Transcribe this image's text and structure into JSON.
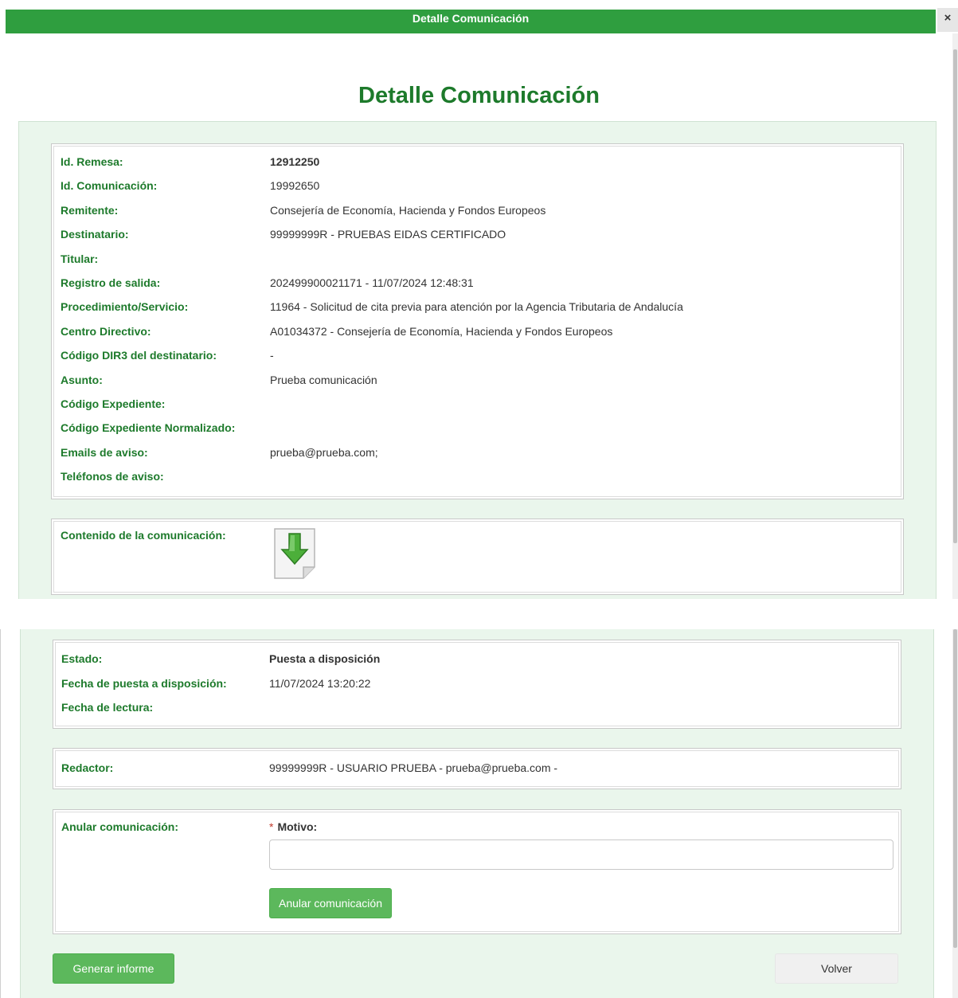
{
  "window": {
    "title": "Detalle Comunicación",
    "close_icon": "×"
  },
  "page_title": "Detalle Comunicación",
  "details": [
    {
      "label": "Id. Remesa:",
      "value": "12912250",
      "bold": true
    },
    {
      "label": "Id. Comunicación:",
      "value": "19992650"
    },
    {
      "label": "Remitente:",
      "value": "Consejería de Economía, Hacienda y Fondos Europeos"
    },
    {
      "label": "Destinatario:",
      "value": "99999999R - PRUEBAS EIDAS CERTIFICADO"
    },
    {
      "label": "Titular:",
      "value": ""
    },
    {
      "label": "Registro de salida:",
      "value": "202499900021171 - 11/07/2024 12:48:31"
    },
    {
      "label": "Procedimiento/Servicio:",
      "value": "11964 - Solicitud de cita previa para atención por la Agencia Tributaria de Andalucía"
    },
    {
      "label": "Centro Directivo:",
      "value": "A01034372 - Consejería de Economía, Hacienda y Fondos Europeos"
    },
    {
      "label": "Código DIR3 del destinatario:",
      "value": "-"
    },
    {
      "label": "Asunto:",
      "value": "Prueba comunicación"
    },
    {
      "label": "Código Expediente:",
      "value": ""
    },
    {
      "label": "Código Expediente Normalizado:",
      "value": ""
    },
    {
      "label": "Emails de aviso:",
      "value": "prueba@prueba.com;"
    },
    {
      "label": "Teléfonos de aviso:",
      "value": ""
    }
  ],
  "content": {
    "label": "Contenido de la comunicación:",
    "icon": "download-document-icon"
  },
  "status": [
    {
      "label": "Estado:",
      "value": "Puesta a disposición",
      "bold": true
    },
    {
      "label": "Fecha de puesta a disposición:",
      "value": "11/07/2024 13:20:22"
    },
    {
      "label": "Fecha de lectura:",
      "value": ""
    }
  ],
  "redactor": {
    "label": "Redactor:",
    "value": "99999999R - USUARIO PRUEBA - prueba@prueba.com -"
  },
  "anular": {
    "label": "Anular comunicación:",
    "required_mark": "*",
    "motivo_label": "Motivo:",
    "motivo_value": "",
    "button": "Anular comunicación"
  },
  "footer": {
    "generar_button": "Generar informe",
    "volver_button": "Volver"
  },
  "colors": {
    "header_bar": "#2f9e3f",
    "label_green": "#1d7a2b",
    "panel_bg": "#eaf6ec",
    "button_green": "#5cb85c"
  }
}
